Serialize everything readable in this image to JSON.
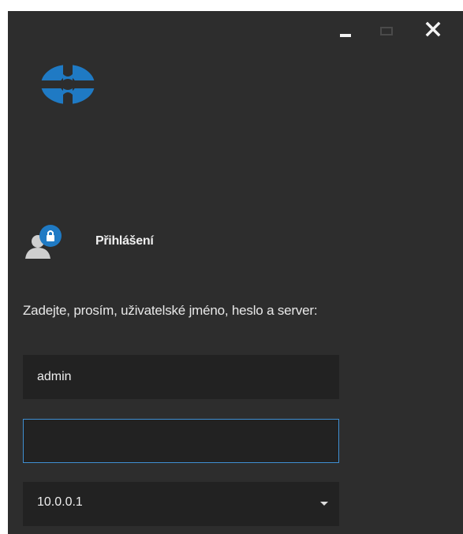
{
  "window": {
    "controls": {
      "minimize": "minimize-icon",
      "maximize": "maximize-icon",
      "close": "close-icon"
    }
  },
  "login": {
    "title": "Přihlášení",
    "prompt": "Zadejte, prosím, uživatelské jméno, heslo a server:"
  },
  "form": {
    "username_value": "admin",
    "password_value": "",
    "server_value": "10.0.0.1"
  },
  "colors": {
    "window_bg": "#2d2d2d",
    "field_bg": "#222222",
    "accent": "#3f8fd2",
    "logo_blue": "#1f7ac4"
  }
}
